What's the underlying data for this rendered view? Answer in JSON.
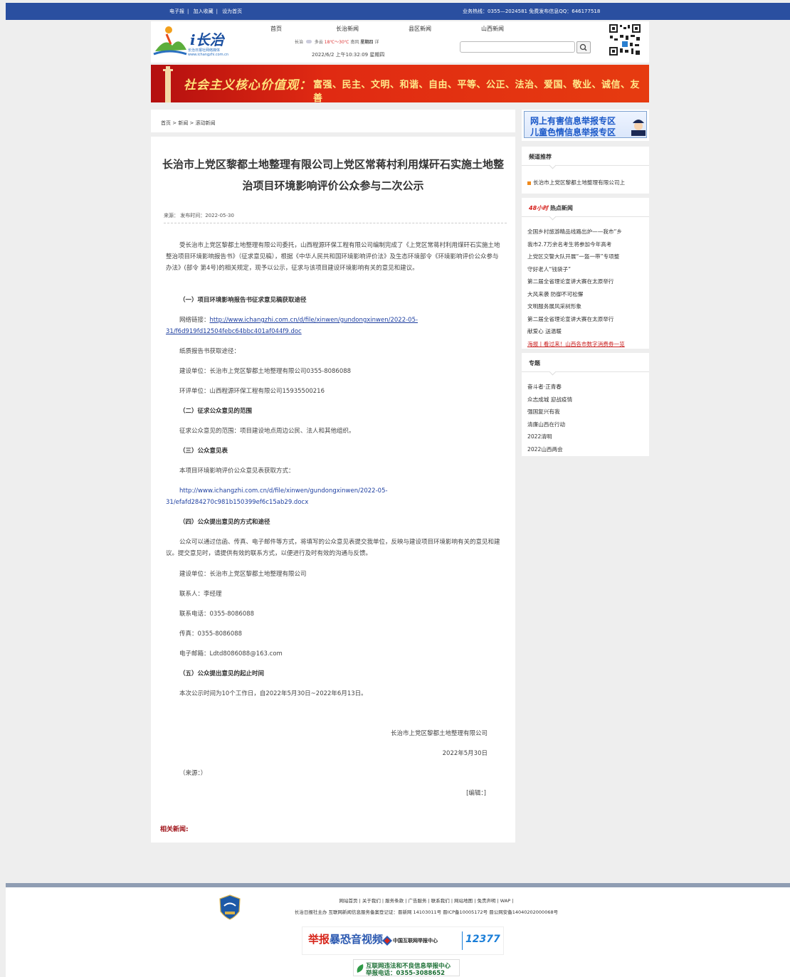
{
  "topbar": {
    "left_links": [
      "电子报",
      "加入收藏",
      "设为首页"
    ],
    "hotline": "业务热线：0355—2024581 免费发布信息QQ：646177518"
  },
  "header": {
    "logo_text": "i长治",
    "logo_sub1": "长治日报社网络媒体",
    "logo_sub2": "www.ichangzhi.com.cn",
    "nav": [
      "首页",
      "长治新闻",
      "县区新闻",
      "山西新闻"
    ],
    "weather": "长治",
    "weather_cond": "多云",
    "weather_temp": "18℃～30℃",
    "weather_wind": "南风",
    "weather_day": "星期四",
    "weather_more": "详",
    "datetime": "2022/6/2 上午10:32:09 星期四",
    "search_placeholder": ""
  },
  "banner": {
    "calligraphy": "社会主义核心价值观：",
    "values": "富强、民主、文明、和谐、自由、平等、公正、法治、爱国、敬业、诚信、友善"
  },
  "breadcrumb": "首页 > 新闻 > 滚动新闻",
  "article": {
    "title": "长治市上党区黎都土地整理有限公司上党区常蒋村利用煤矸石实施土地整治项目环境影响评价公众参与二次公示",
    "source_line": "来源：  发布时间：2022-05-30",
    "p1": "受长治市上党区黎都土地整理有限公司委托，山西程源环保工程有限公司编制完成了《上党区常蒋村利用煤矸石实施土地整治项目环境影响报告书》（征求意见稿），根据《中华人民共和国环境影响评价法》及生态环境部令《环境影响评价公众参与办法》(部令 第4号)的相关规定，现予以公示，征求与该项目建设环境影响有关的意见和建议。",
    "h1": "（一）项目环境影响报告书征求意见稿获取途径",
    "net_label": "网络链接：",
    "net_link": "http://www.ichangzhi.com.cn/d/file/xinwen/gundongxinwen/2022-05-31/f6d919fd12504febc64bbc401af044f9.doc",
    "paper": "纸质报告书获取途径：",
    "builder": "建设单位：长治市上党区黎都土地整理有限公司0355-8086088",
    "evaluator": "环评单位：山西程源环保工程有限公司15935500216",
    "h2": "（二）征求公众意见的范围",
    "scope": "征求公众意见的范围：项目建设地点周边公民、法人和其他组织。",
    "h3": "（三）公众意见表",
    "form_label": "本项目环境影响评价公众意见表获取方式：",
    "form_link": "http://www.ichangzhi.com.cn/d/file/xinwen/gundongxinwen/2022-05-31/efafd284270c981b150399ef6c15ab29.docx",
    "h4": "（四）公众提出意见的方式和途径",
    "method": "公众可以通过信函、传真、电子邮件等方式，将填写的公众意见表提交我单位，反映与建设项目环境影响有关的意见和建议。提交意见时，请提供有效的联系方式，以便进行及时有效的沟通与反馈。",
    "builder2": "建设单位：长治市上党区黎都土地整理有限公司",
    "contact": "联系人：李经理",
    "phone": "联系电话：0355-8086088",
    "fax": "传真：0355-8086088",
    "email": "电子邮箱：Ldtd8086088@163.com",
    "h5": "（五）公众提出意见的起止时间",
    "period": "本次公示时间为10个工作日，自2022年5月30日~2022年6月13日。",
    "sign_company": "长治市上党区黎都土地整理有限公司",
    "sign_date": "2022年5月30日",
    "source_note": "（来源：）",
    "editor": "[编辑：]",
    "related": "相关新闻:"
  },
  "sidebar": {
    "report_line1": "网上有害信息举报专区",
    "report_line2": "儿童色情信息举报专区",
    "recommend_title": "频道推荐",
    "recommend_item": "长治市上党区黎都土地整理有限公司上",
    "hot_prefix": "48小时",
    "hot_title": "热点新闻",
    "hot_items": [
      "全国乡村旅游精品线路出炉——我市“乡",
      "我市2.7万余名考生将参加今年高考",
      "上党区交警大队开展“一盔一带”专项整",
      "守好老人“钱袋子”",
      "第二届全省理论宣讲大赛在太原举行",
      "大风来袭 防御不可松懈",
      "文明服务展风采树形象",
      "第二届全省理论宣讲大赛在太原举行",
      "献爱心 送温暖",
      "海报丨看过来！山西各市数字消费券一览"
    ],
    "topic_title": "专题",
    "topics": [
      "奋斗者·正青春",
      "众志成城 迎战疫情",
      "强国复兴有我",
      "清廉山西在行动",
      "2022清明",
      "2022山西两会"
    ]
  },
  "footer": {
    "links": "网站首页 | 关于我们 | 服务条款 | 广告服务 | 联系我们 | 网站地图 | 免责声明 | WAP |",
    "license": "长治日报社主办  互联网新闻信息服务备案登记证：晋新网 14103011号 晋ICP备10005172号 晋公网安备14040202000068号",
    "report_brand_red": "举报",
    "report_brand_blue": "暴恐音视频",
    "report_center": "中国互联网举报中心",
    "hotline_12377": "12377",
    "illegal_line1": "互联网违法和不良信息举报中心",
    "illegal_line2": "举报电话：0355-3088652"
  }
}
